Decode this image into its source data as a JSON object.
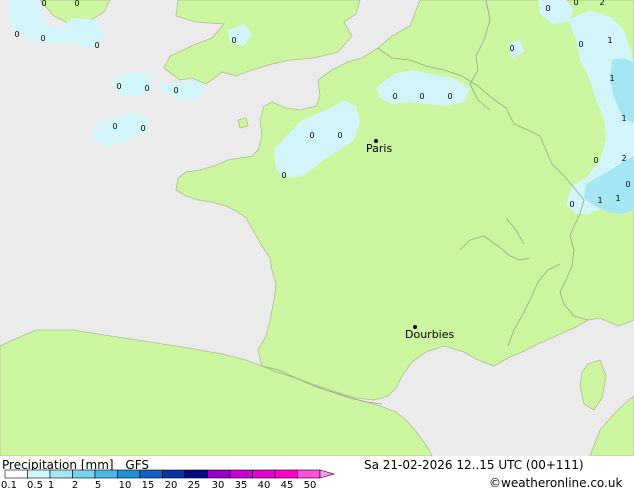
{
  "map": {
    "colors": {
      "sea": "#ebebeb",
      "land": "#ccf5a0",
      "light_rain": "#d2f5fa",
      "moderate_rain": "#a5e6f5",
      "border": "#9aa58a"
    },
    "cities": [
      {
        "name": "Paris"
      },
      {
        "name": "Dourbies"
      }
    ],
    "values": [
      "0",
      "0",
      "0",
      "0",
      "0",
      "0",
      "0",
      "0",
      "0",
      "0",
      "0",
      "0",
      "0",
      "0",
      "0",
      "0",
      "0",
      "0",
      "0",
      "0",
      "1",
      "2",
      "0",
      "1",
      "1",
      "0",
      "2",
      "0",
      "1",
      "0",
      "1"
    ]
  },
  "legend": {
    "title": "Precipitation [mm]",
    "model": "GFS",
    "ticks": [
      "0.1",
      "0.5",
      "1",
      "2",
      "5",
      "10",
      "15",
      "20",
      "25",
      "30",
      "35",
      "40",
      "45",
      "50"
    ],
    "colors": [
      "#fdfdfd",
      "#d2f5fa",
      "#a5e6f5",
      "#79d2f0",
      "#4ab9e6",
      "#1f8fd2",
      "#1460c0",
      "#0a32a6",
      "#050a82",
      "#9600c8",
      "#c800d2",
      "#e600d6",
      "#ff00c8",
      "#ff50dc",
      "#ff96e6"
    ]
  },
  "footer": {
    "datetime": "Sa 21-02-2026 12..15 UTC (00+111)",
    "credit": "©weatheronline.co.uk"
  }
}
